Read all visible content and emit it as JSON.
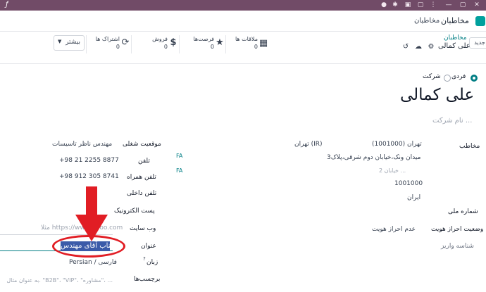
{
  "navbar": {
    "app_name": "مخاطبان",
    "menu_contacts": "مخاطبان"
  },
  "control_panel": {
    "new_button": "جدید",
    "breadcrumb_parent": "مخاطبان",
    "breadcrumb_current": "علی کمالی",
    "stats": [
      {
        "label": "ملاقات ها",
        "value": "0",
        "icon": "calendar-icon"
      },
      {
        "label": "فرصت‌ها",
        "value": "0",
        "icon": "star-icon"
      },
      {
        "label": "فروش",
        "value": "0",
        "icon": "dollar-icon"
      },
      {
        "label": "اشتراک ها",
        "value": "0",
        "icon": "refresh-icon"
      }
    ],
    "more_button": "بیشتر"
  },
  "form": {
    "type_individual": "فردی",
    "type_company": "شرکت",
    "name": "علی کمالی",
    "company_placeholder": "نام شرکت ...",
    "left_column": {
      "contact_label": "مخاطب",
      "city": "تهران (1001000)",
      "state": "تهران (IR)",
      "street": "میدان ونک،خیابان دوم شرقی،پلاک3",
      "street2_placeholder": "خیابان 2 ...",
      "zip": "1001000",
      "country": "ایران",
      "national_id_label": "شماره ملی",
      "identity_status_label": "وضعیت احراز هویت",
      "identity_status_value": "عدم احراز هویت",
      "deposit_id_label": "شناسه واریز"
    },
    "right_column": {
      "job_position_label": "موقعیت شغلی",
      "job_position_value": "مهندس ناظر تاسیسات",
      "phone_label": "تلفن",
      "phone_value": "+98 21 2255 8877",
      "mobile_label": "تلفن همراه",
      "mobile_value": "+98 912 305 8741",
      "internal_phone_label": "تلفن داخلی",
      "email_label": "پست الکترونیک",
      "website_label": "وب سایت",
      "website_placeholder": "مثلا https://www.odoo.com",
      "title_label": "عنوان",
      "title_value": "جناب آقای مهندس",
      "language_label": "زبان",
      "language_help": "?",
      "language_value": "Persian / فارسی",
      "tags_label": "برچسب‌ها",
      "tags_placeholder": "به عنوان مثال. \"B2B\"، \"VIP\"، \"مشاوره\"، ..."
    },
    "fa_badge": "FA"
  },
  "colors": {
    "brand": "#714b67",
    "accent": "#017e84",
    "annotation": "#e11d24",
    "selection": "#3b5ba9"
  }
}
